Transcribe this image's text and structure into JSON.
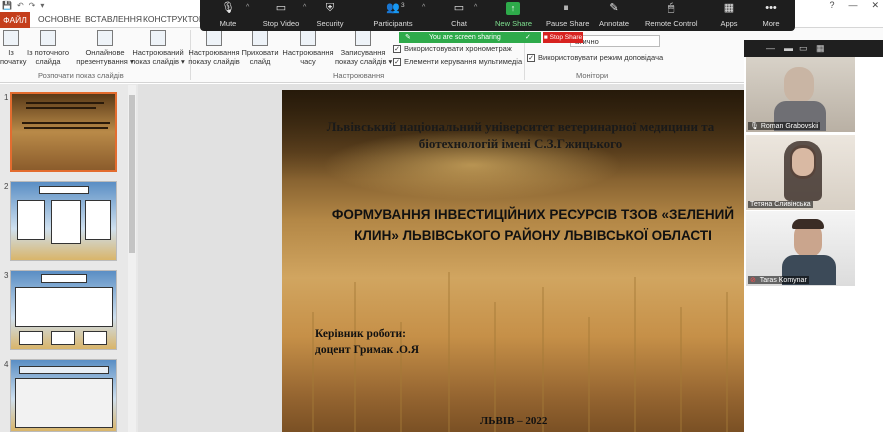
{
  "title_bar": {
    "quick_access": [
      "💾",
      "↶",
      "↷",
      "▾"
    ],
    "window_controls": [
      "?",
      "—",
      "✕"
    ]
  },
  "tabs": {
    "file": "ФАЙЛ",
    "home": "ОСНОВНЕ",
    "insert": "ВСТАВЛЕННЯ",
    "design": "КОНСТРУКТОР"
  },
  "ribbon": {
    "from_beginning": "Із\nпочатку",
    "from_current": "Із поточного\nслайда",
    "present_online": "Онлайнове\nпрезентування ▾",
    "custom_show": "Настроюваний\nпоказ слайдів ▾",
    "group_start": "Розпочати показ слайдів",
    "setup_show": "Настроювання\nпоказу слайдів",
    "hide_slide": "Приховати\nслайд",
    "rehearse": "Настроювання\nчасу",
    "record": "Записування\nпоказу слайдів ▾",
    "group_setup": "Настроювання",
    "use_timings": "Використовувати хронометраж",
    "media_controls": "Елементи керування мультимедіа",
    "monitor_value": "атично",
    "presenter_view": "Використовувати режим доповідача",
    "group_monitors": "Монітори"
  },
  "zoom_toolbar": {
    "mute": "Mute",
    "stop_video": "Stop Video",
    "security": "Security",
    "participants": "Participants",
    "participants_count": "3",
    "chat": "Chat",
    "new_share": "New Share",
    "pause_share": "Pause Share",
    "annotate": "Annotate",
    "remote_control": "Remote Control",
    "apps": "Apps",
    "more": "More"
  },
  "sharing": {
    "banner": "You are screen sharing",
    "stop": "Stop Share"
  },
  "slides_panel": {
    "numbers": [
      "1",
      "2",
      "3",
      "4"
    ]
  },
  "slide": {
    "title": "Львівський національний університет ветеринарної медицини та біотехнологій імені С.З.Гжицького",
    "topic": "ФОРМУВАННЯ  ІНВЕСТИЦІЙНИХ РЕСУРСІВ ТЗОВ «ЗЕЛЕНИЙ КЛИН» ЛЬВІВСЬКОГО РАЙОНУ ЛЬВІВСЬКОЇ ОБЛАСТІ",
    "supervisor_label": "Керівник роботи:",
    "supervisor_name": "доцент Гримак .О.Я",
    "city_year": "ЛЬВІВ – 2022"
  },
  "participants": [
    {
      "name": "Roman Grabovskii",
      "muted": false
    },
    {
      "name": "Тетяна Сливінська",
      "muted": false
    },
    {
      "name": "Taras Komynar",
      "muted": true
    }
  ],
  "colors": {
    "file_tab": "#c43e1c",
    "share_green": "#2eaa4a",
    "stop_red": "#d7221f",
    "zoom_dark": "#1e1e1e",
    "selected_thumb": "#e36c2f"
  }
}
